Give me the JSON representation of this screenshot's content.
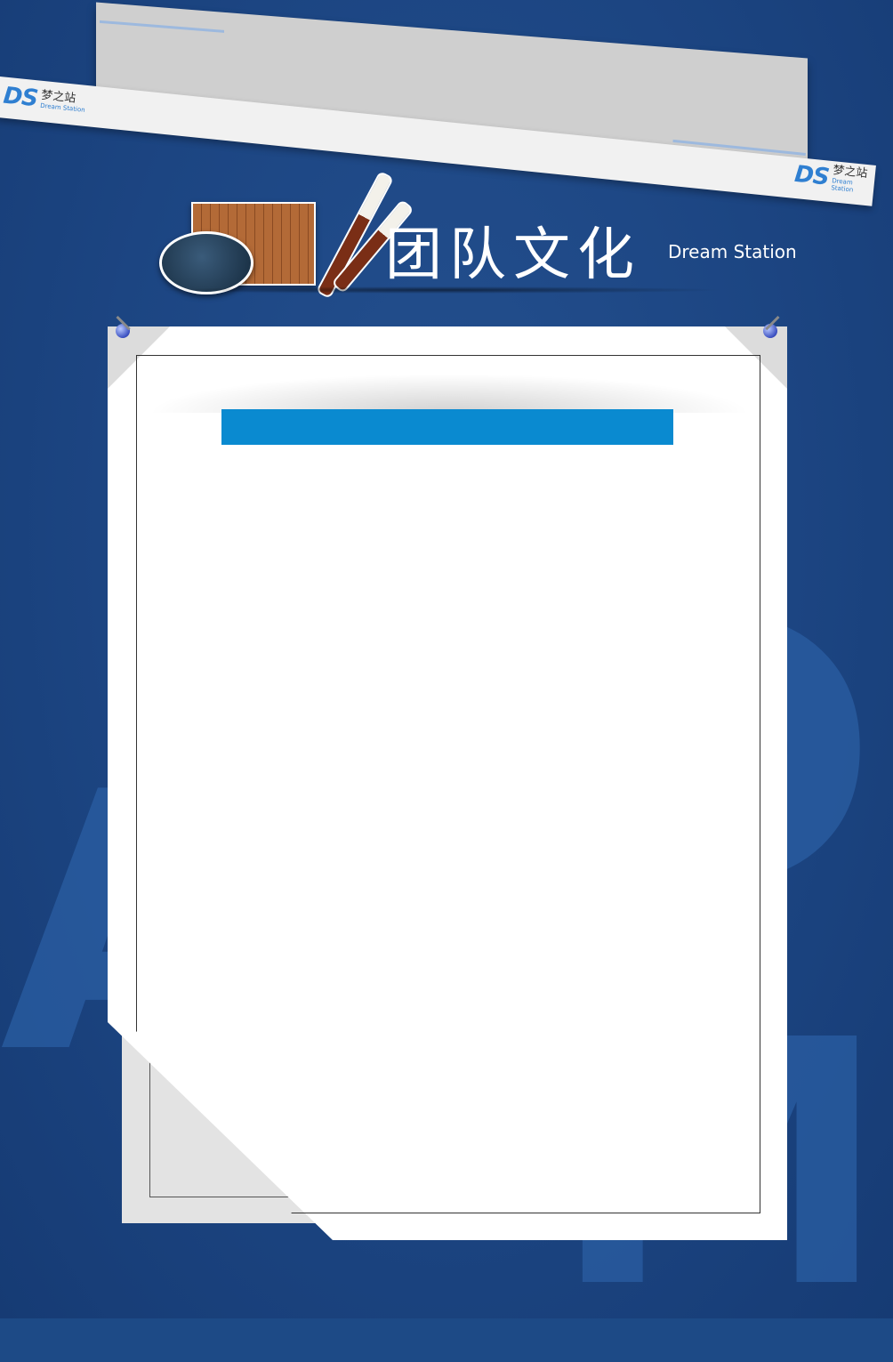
{
  "title": {
    "chinese": "团队文化",
    "english": "Dream Station"
  },
  "logo": {
    "mark": "DS",
    "chinese": "梦之站",
    "english": "Dream Station"
  },
  "content": {
    "heading_text": ""
  },
  "icons": [
    "ink-stone-icon",
    "bamboo-scroll-icon",
    "calligraphy-brush-icon",
    "push-pin-icon"
  ],
  "colors": {
    "background": "#1d4a86",
    "accent_bar": "#0a8ad0",
    "paper": "#ffffff"
  }
}
